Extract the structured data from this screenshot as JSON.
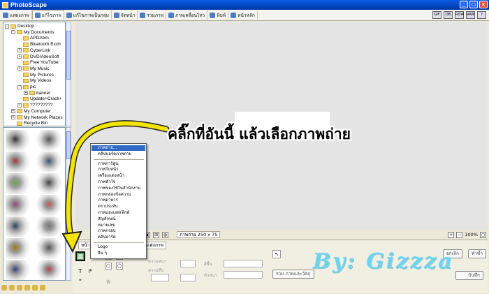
{
  "window": {
    "title": "PhotoScape",
    "buttons": [
      "_",
      "□",
      "×"
    ]
  },
  "toolbar": {
    "tabs": [
      {
        "label": "แสดงภาพ"
      },
      {
        "label": "แก้ไขภาพ"
      },
      {
        "label": "แก้ไขภาพเป็นกลุ่ม"
      },
      {
        "label": "จัดหน้า"
      },
      {
        "label": "รวมภาพ"
      },
      {
        "label": "ภาพเคลื่อนไหว"
      },
      {
        "label": "พิมพ์"
      },
      {
        "label": "หน้าหลัก"
      }
    ],
    "active_tab": 1,
    "right_icons": [
      "GIF",
      "DB",
      "ROW",
      "RAW",
      "?"
    ]
  },
  "tree": {
    "items": [
      {
        "label": "Desktop",
        "depth": 0,
        "exp": "-"
      },
      {
        "label": "My Documents",
        "depth": 1,
        "exp": "-"
      },
      {
        "label": "APDAbm",
        "depth": 2,
        "exp": ""
      },
      {
        "label": "Bluetooth Exch",
        "depth": 2,
        "exp": ""
      },
      {
        "label": "CyberLink",
        "depth": 2,
        "exp": "+"
      },
      {
        "label": "DVDVideoSoft",
        "depth": 2,
        "exp": "+"
      },
      {
        "label": "Free YouTube",
        "depth": 2,
        "exp": ""
      },
      {
        "label": "My Music",
        "depth": 2,
        "exp": "+"
      },
      {
        "label": "My Pictures",
        "depth": 2,
        "exp": ""
      },
      {
        "label": "My Videos",
        "depth": 2,
        "exp": ""
      },
      {
        "label": "pic",
        "depth": 2,
        "exp": "-"
      },
      {
        "label": "banner",
        "depth": 3,
        "exp": "+"
      },
      {
        "label": "Update+Crack+",
        "depth": 2,
        "exp": ""
      },
      {
        "label": "?????????",
        "depth": 2,
        "exp": "+"
      },
      {
        "label": "My Computer",
        "depth": 1,
        "exp": "+"
      },
      {
        "label": "My Network Places",
        "depth": 1,
        "exp": "+"
      },
      {
        "label": "Recycle Bin",
        "depth": 1,
        "exp": ""
      }
    ]
  },
  "status": {
    "image_size": "ภาพถ่าย 250 x 75",
    "zoom": "100%"
  },
  "panel": {
    "tab_home": "หน้า",
    "tab_object": "ตกแต่งภาพ",
    "labels": [
      "ความหนา",
      "ความทึบ",
      "สีพื้น",
      "ตัวหนา"
    ],
    "undo": "ยกเลิก",
    "redo": "ทำซ้ำ",
    "merge": "รวม ภาพและวัตถุ",
    "save": "บันทึก"
  },
  "menu": {
    "items": [
      "ภาพถ่าย...",
      "คลิปบอร์ดภาพถ่าย",
      "ภาพการ์ตูน",
      "ภาพใบหน้า",
      "เครื่องแต่งหน้า",
      "ภาพหัวใจ",
      "ภาพของใช้ในสำนักงาน",
      "ภาพกล่องข้อความ",
      "ภาพอาหาร",
      "ตราประทับ",
      "ภาพแสงเอฟเฟ็กต์",
      "สัญลักษณ์",
      "หมายเลข",
      "ภาพกรอบ",
      "คลิปอาร์ต",
      "Logo",
      "อื่น ๆ"
    ],
    "selected": 0
  },
  "annotation": {
    "callout": "คลิ๊กที่อันนี้ แล้วเลือกภาพถ่าย",
    "watermark": "By: Gizzza"
  },
  "colors": {
    "arrow": "#f5e400",
    "menu_highlight": "#316ac5",
    "titlebar": "#0a5de6"
  }
}
